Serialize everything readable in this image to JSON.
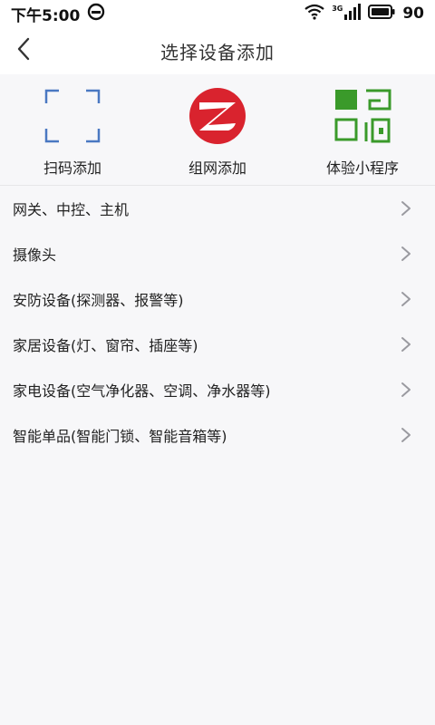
{
  "status_bar": {
    "time": "下午5:00",
    "network": "3G",
    "battery": "90"
  },
  "header": {
    "title": "选择设备添加"
  },
  "quick_add": [
    {
      "label": "扫码添加",
      "icon": "scan-frame-icon",
      "color": "#4a78c2"
    },
    {
      "label": "组网添加",
      "icon": "zigbee-logo-icon",
      "color": "#d9232e"
    },
    {
      "label": "体验小程序",
      "icon": "qr-code-icon",
      "color": "#3a9a2a"
    }
  ],
  "categories": [
    {
      "label": "网关、中控、主机"
    },
    {
      "label": "摄像头"
    },
    {
      "label": "安防设备(探测器、报警等)"
    },
    {
      "label": "家居设备(灯、窗帘、插座等)"
    },
    {
      "label": "家电设备(空气净化器、空调、净水器等)"
    },
    {
      "label": "智能单品(智能门锁、智能音箱等)"
    }
  ]
}
